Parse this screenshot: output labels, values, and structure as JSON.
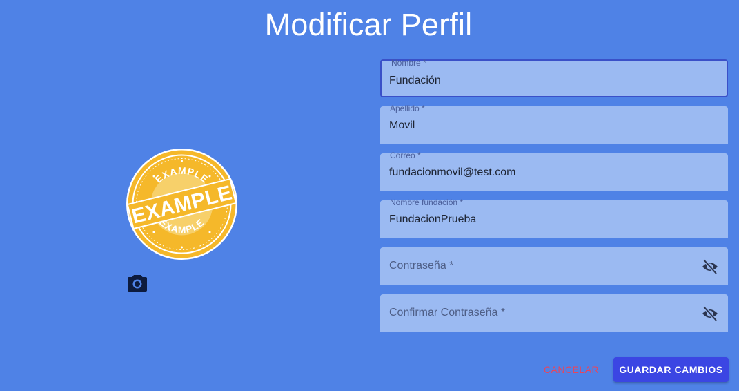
{
  "page": {
    "title": "Modificar Perfil"
  },
  "avatar": {
    "badge_text": "EXAMPLE",
    "badge_arc_top": "EXAMPLE",
    "badge_arc_bottom": "EXAMPLE",
    "badge_color": "#f5b82a"
  },
  "camera_icon": "camera-icon",
  "form": {
    "nombre": {
      "label": "Nombre *",
      "value": "Fundación"
    },
    "apellido": {
      "label": "Apellido *",
      "value": "Movil"
    },
    "correo": {
      "label": "Correo *",
      "value": "fundacionmovil@test.com"
    },
    "nombre_fundacion": {
      "label": "Nombre fundación *",
      "value": "FundacionPrueba"
    },
    "contrasena": {
      "placeholder": "Contraseña *",
      "icon": "eye-off-icon"
    },
    "confirmar_contrasena": {
      "placeholder": "Confirmar Contraseña *",
      "icon": "eye-off-icon"
    }
  },
  "actions": {
    "cancel_label": "CANCELAR",
    "save_label": "GUARDAR CAMBIOS"
  },
  "colors": {
    "background": "#4f82e6",
    "field_background": "#9bbaf2",
    "focus_border": "#3a50c8",
    "cancel_text": "#e8455c",
    "save_button": "#3b46e3"
  }
}
